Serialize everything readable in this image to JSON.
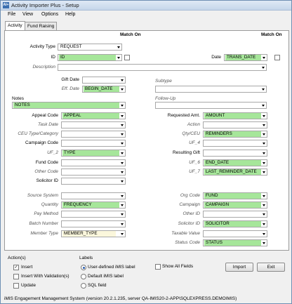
{
  "window": {
    "title": "Activity Importer Plus - Setup",
    "app_icon_text": "AI+"
  },
  "menu": [
    "File",
    "View",
    "Options",
    "Help"
  ],
  "tabs": [
    "Activity",
    "Fund Raising"
  ],
  "match_on_left": "Match On",
  "match_on_right": "Match On",
  "fields": {
    "activity_type": {
      "label": "Activity Type",
      "value": "REQUEST"
    },
    "id": {
      "label": "ID",
      "value": "ID"
    },
    "date": {
      "label": "Date",
      "value": "TRANS_DATE"
    },
    "description": {
      "label": "Description",
      "value": ""
    },
    "gift_date": {
      "label": "Gift Date",
      "value": ""
    },
    "eff_date": {
      "label": "Eff. Date",
      "value": "BEGIN_DATE"
    },
    "subtype": {
      "label": "Subtype",
      "value": ""
    },
    "notes": {
      "label": "Notes",
      "value": "NOTES"
    },
    "follow_up": {
      "label": "Follow-Up",
      "value": ""
    },
    "appeal_code": {
      "label": "Appeal Code",
      "value": "APPEAL"
    },
    "requested_amt": {
      "label": "Requested Amt.",
      "value": "AMOUNT"
    },
    "task_date": {
      "label": "Task Date",
      "value": ""
    },
    "action": {
      "label": "Action",
      "value": ""
    },
    "ceu_type": {
      "label": "CEU Type/Category",
      "value": ""
    },
    "qty_ceu": {
      "label": "Qty/CEU",
      "value": "REMINDERS"
    },
    "campaign_code": {
      "label": "Campaign Code",
      "value": ""
    },
    "uf_4": {
      "label": "UF_4",
      "value": ""
    },
    "uf_2": {
      "label": "UF_2",
      "value": "TYPE"
    },
    "resulting_gift": {
      "label": "Resulting Gift",
      "value": ""
    },
    "fund_code": {
      "label": "Fund Code",
      "value": ""
    },
    "uf_6": {
      "label": "UF_6",
      "value": "END_DATE"
    },
    "other_code": {
      "label": "Other Code",
      "value": ""
    },
    "uf_7": {
      "label": "UF_7",
      "value": "LAST_REMINDER_DATE"
    },
    "solicitor_id_left": {
      "label": "Solicitor ID",
      "value": ""
    },
    "source_system": {
      "label": "Source System",
      "value": ""
    },
    "org_code": {
      "label": "Org Code",
      "value": "FUND"
    },
    "quantity": {
      "label": "Quantity",
      "value": "FREQUENCY"
    },
    "campaign": {
      "label": "Campaign",
      "value": "CAMPAIGN"
    },
    "pay_method": {
      "label": "Pay Method",
      "value": ""
    },
    "other_id": {
      "label": "Other ID",
      "value": ""
    },
    "batch_number": {
      "label": "Batch Number",
      "value": ""
    },
    "solicitor_id_right": {
      "label": "Solicitor ID",
      "value": "SOLICITOR"
    },
    "member_type": {
      "label": "Member Type",
      "value": "MEMBER_TYPE"
    },
    "taxable_value": {
      "label": "Taxable Value",
      "value": ""
    },
    "status_code": {
      "label": "Status Code",
      "value": "STATUS"
    }
  },
  "actions": {
    "title": "Action(s)",
    "insert": {
      "label": "Insert",
      "checked": true
    },
    "insert_with_validation": {
      "label": "Insert With Validation(s)",
      "checked": false
    },
    "update": {
      "label": "Update",
      "checked": false
    }
  },
  "labels": {
    "title": "Labels",
    "user_defined": "User-defined iMIS label",
    "default": "Default iMIS label",
    "sql": "SQL field",
    "selected": "user_defined"
  },
  "show_all_fields": {
    "label": "Show All Fields",
    "checked": false
  },
  "buttons": {
    "import": "Import",
    "exit": "Exit"
  },
  "status_bar": "iMIS Engagement Management System  (version 20.2.1.235, server QA-IMIS20-2-APP\\SQLEXPRESS.DEMOIMIS)",
  "colors": {
    "highlight": "#a6e69a",
    "accent": "#2a5db0"
  }
}
